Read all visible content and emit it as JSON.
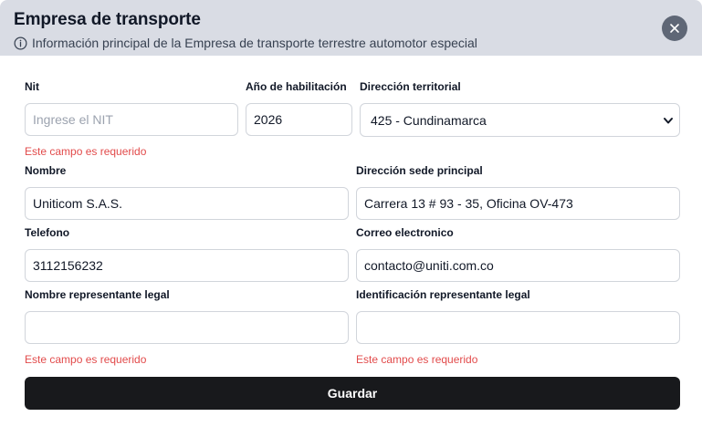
{
  "header": {
    "title": "Empresa de transporte",
    "subtitle": "Información principal de la Empresa de transporte terrestre automotor especial"
  },
  "icons": {
    "info": "info-circle-icon",
    "close": "close-x-icon",
    "dropdown": "chevron-down-icon"
  },
  "form": {
    "nit": {
      "label": "Nit",
      "value": "",
      "placeholder": "Ingrese el NIT",
      "error": "Este campo es requerido"
    },
    "anio": {
      "label": "Año de habilitación",
      "value": "2026"
    },
    "direccion_territorial": {
      "label": "Dirección territorial",
      "selected": "425 - Cundinamarca"
    },
    "nombre": {
      "label": "Nombre",
      "value": "Uniticom S.A.S."
    },
    "direccion_sede": {
      "label": "Dirección sede principal",
      "value": "Carrera 13 # 93 - 35, Oficina OV-473"
    },
    "telefono": {
      "label": "Telefono",
      "value": "3112156232"
    },
    "correo": {
      "label": "Correo electronico",
      "value": "contacto@uniti.com.co"
    },
    "representante_nombre": {
      "label": "Nombre representante legal",
      "value": "",
      "error": "Este campo es requerido"
    },
    "representante_id": {
      "label": "Identificación representante legal",
      "value": "",
      "error": "Este campo es requerido"
    }
  },
  "actions": {
    "save_label": "Guardar"
  },
  "colors": {
    "header_bg": "#d9dce4",
    "close_bg": "#5f6776",
    "error": "#e24b4b",
    "button_bg": "#18191c"
  }
}
